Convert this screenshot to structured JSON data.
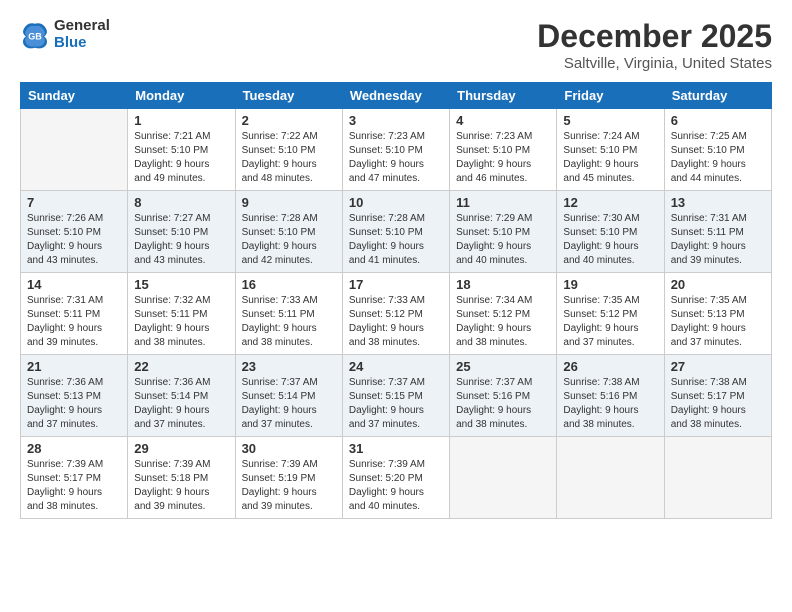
{
  "header": {
    "logo_general": "General",
    "logo_blue": "Blue",
    "month_title": "December 2025",
    "location": "Saltville, Virginia, United States"
  },
  "weekdays": [
    "Sunday",
    "Monday",
    "Tuesday",
    "Wednesday",
    "Thursday",
    "Friday",
    "Saturday"
  ],
  "weeks": [
    [
      {
        "day": "",
        "sunrise": "",
        "sunset": "",
        "daylight": ""
      },
      {
        "day": "1",
        "sunrise": "Sunrise: 7:21 AM",
        "sunset": "Sunset: 5:10 PM",
        "daylight": "Daylight: 9 hours and 49 minutes."
      },
      {
        "day": "2",
        "sunrise": "Sunrise: 7:22 AM",
        "sunset": "Sunset: 5:10 PM",
        "daylight": "Daylight: 9 hours and 48 minutes."
      },
      {
        "day": "3",
        "sunrise": "Sunrise: 7:23 AM",
        "sunset": "Sunset: 5:10 PM",
        "daylight": "Daylight: 9 hours and 47 minutes."
      },
      {
        "day": "4",
        "sunrise": "Sunrise: 7:23 AM",
        "sunset": "Sunset: 5:10 PM",
        "daylight": "Daylight: 9 hours and 46 minutes."
      },
      {
        "day": "5",
        "sunrise": "Sunrise: 7:24 AM",
        "sunset": "Sunset: 5:10 PM",
        "daylight": "Daylight: 9 hours and 45 minutes."
      },
      {
        "day": "6",
        "sunrise": "Sunrise: 7:25 AM",
        "sunset": "Sunset: 5:10 PM",
        "daylight": "Daylight: 9 hours and 44 minutes."
      }
    ],
    [
      {
        "day": "7",
        "sunrise": "Sunrise: 7:26 AM",
        "sunset": "Sunset: 5:10 PM",
        "daylight": "Daylight: 9 hours and 43 minutes."
      },
      {
        "day": "8",
        "sunrise": "Sunrise: 7:27 AM",
        "sunset": "Sunset: 5:10 PM",
        "daylight": "Daylight: 9 hours and 43 minutes."
      },
      {
        "day": "9",
        "sunrise": "Sunrise: 7:28 AM",
        "sunset": "Sunset: 5:10 PM",
        "daylight": "Daylight: 9 hours and 42 minutes."
      },
      {
        "day": "10",
        "sunrise": "Sunrise: 7:28 AM",
        "sunset": "Sunset: 5:10 PM",
        "daylight": "Daylight: 9 hours and 41 minutes."
      },
      {
        "day": "11",
        "sunrise": "Sunrise: 7:29 AM",
        "sunset": "Sunset: 5:10 PM",
        "daylight": "Daylight: 9 hours and 40 minutes."
      },
      {
        "day": "12",
        "sunrise": "Sunrise: 7:30 AM",
        "sunset": "Sunset: 5:10 PM",
        "daylight": "Daylight: 9 hours and 40 minutes."
      },
      {
        "day": "13",
        "sunrise": "Sunrise: 7:31 AM",
        "sunset": "Sunset: 5:11 PM",
        "daylight": "Daylight: 9 hours and 39 minutes."
      }
    ],
    [
      {
        "day": "14",
        "sunrise": "Sunrise: 7:31 AM",
        "sunset": "Sunset: 5:11 PM",
        "daylight": "Daylight: 9 hours and 39 minutes."
      },
      {
        "day": "15",
        "sunrise": "Sunrise: 7:32 AM",
        "sunset": "Sunset: 5:11 PM",
        "daylight": "Daylight: 9 hours and 38 minutes."
      },
      {
        "day": "16",
        "sunrise": "Sunrise: 7:33 AM",
        "sunset": "Sunset: 5:11 PM",
        "daylight": "Daylight: 9 hours and 38 minutes."
      },
      {
        "day": "17",
        "sunrise": "Sunrise: 7:33 AM",
        "sunset": "Sunset: 5:12 PM",
        "daylight": "Daylight: 9 hours and 38 minutes."
      },
      {
        "day": "18",
        "sunrise": "Sunrise: 7:34 AM",
        "sunset": "Sunset: 5:12 PM",
        "daylight": "Daylight: 9 hours and 38 minutes."
      },
      {
        "day": "19",
        "sunrise": "Sunrise: 7:35 AM",
        "sunset": "Sunset: 5:12 PM",
        "daylight": "Daylight: 9 hours and 37 minutes."
      },
      {
        "day": "20",
        "sunrise": "Sunrise: 7:35 AM",
        "sunset": "Sunset: 5:13 PM",
        "daylight": "Daylight: 9 hours and 37 minutes."
      }
    ],
    [
      {
        "day": "21",
        "sunrise": "Sunrise: 7:36 AM",
        "sunset": "Sunset: 5:13 PM",
        "daylight": "Daylight: 9 hours and 37 minutes."
      },
      {
        "day": "22",
        "sunrise": "Sunrise: 7:36 AM",
        "sunset": "Sunset: 5:14 PM",
        "daylight": "Daylight: 9 hours and 37 minutes."
      },
      {
        "day": "23",
        "sunrise": "Sunrise: 7:37 AM",
        "sunset": "Sunset: 5:14 PM",
        "daylight": "Daylight: 9 hours and 37 minutes."
      },
      {
        "day": "24",
        "sunrise": "Sunrise: 7:37 AM",
        "sunset": "Sunset: 5:15 PM",
        "daylight": "Daylight: 9 hours and 37 minutes."
      },
      {
        "day": "25",
        "sunrise": "Sunrise: 7:37 AM",
        "sunset": "Sunset: 5:16 PM",
        "daylight": "Daylight: 9 hours and 38 minutes."
      },
      {
        "day": "26",
        "sunrise": "Sunrise: 7:38 AM",
        "sunset": "Sunset: 5:16 PM",
        "daylight": "Daylight: 9 hours and 38 minutes."
      },
      {
        "day": "27",
        "sunrise": "Sunrise: 7:38 AM",
        "sunset": "Sunset: 5:17 PM",
        "daylight": "Daylight: 9 hours and 38 minutes."
      }
    ],
    [
      {
        "day": "28",
        "sunrise": "Sunrise: 7:39 AM",
        "sunset": "Sunset: 5:17 PM",
        "daylight": "Daylight: 9 hours and 38 minutes."
      },
      {
        "day": "29",
        "sunrise": "Sunrise: 7:39 AM",
        "sunset": "Sunset: 5:18 PM",
        "daylight": "Daylight: 9 hours and 39 minutes."
      },
      {
        "day": "30",
        "sunrise": "Sunrise: 7:39 AM",
        "sunset": "Sunset: 5:19 PM",
        "daylight": "Daylight: 9 hours and 39 minutes."
      },
      {
        "day": "31",
        "sunrise": "Sunrise: 7:39 AM",
        "sunset": "Sunset: 5:20 PM",
        "daylight": "Daylight: 9 hours and 40 minutes."
      },
      {
        "day": "",
        "sunrise": "",
        "sunset": "",
        "daylight": ""
      },
      {
        "day": "",
        "sunrise": "",
        "sunset": "",
        "daylight": ""
      },
      {
        "day": "",
        "sunrise": "",
        "sunset": "",
        "daylight": ""
      }
    ]
  ],
  "colors": {
    "header_bg": "#1a6fba",
    "row_shade": "#edf2f7"
  }
}
